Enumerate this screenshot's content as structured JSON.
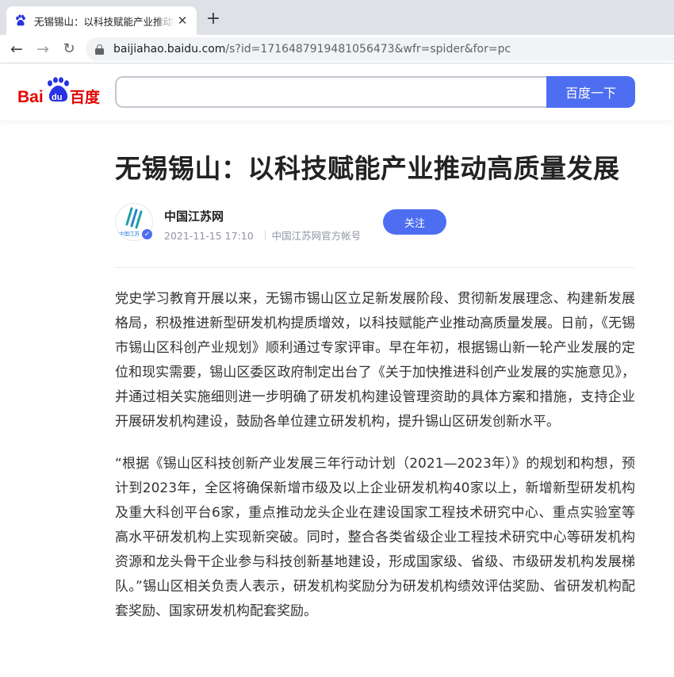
{
  "browser": {
    "tab_title": "无锡锡山：以科技赋能产业推动高质量发展",
    "tab_close": "✕",
    "new_tab": "+",
    "url_host": "baijiahao.baidu.com",
    "url_path": "/s?id=1716487919481056473&wfr=spider&for=pc"
  },
  "header": {
    "logo_text": "Bai du 百度",
    "search_value": "",
    "search_button": "百度一下",
    "brand_blue": "#4e6ef2",
    "brand_red": "#e10602"
  },
  "article": {
    "title": "无锡锡山：以科技赋能产业推动高质量发展",
    "author": {
      "avatar_text": "中国江苏",
      "name": "中国江苏网",
      "date": "2021-11-15 17:10",
      "account": "中国江苏网官方帐号",
      "follow": "关注"
    },
    "paragraphs": [
      "党史学习教育开展以来，无锡市锡山区立足新发展阶段、贯彻新发展理念、构建新发展格局，积极推进新型研发机构提质增效，以科技赋能产业推动高质量发展。日前，《无锡市锡山区科创产业规划》顺利通过专家评审。早在年初，根据锡山新一轮产业发展的定位和现实需要，锡山区委区政府制定出台了《关于加快推进科创产业发展的实施意见》，并通过相关实施细则进一步明确了研发机构建设管理资助的具体方案和措施，支持企业开展研发机构建设，鼓励各单位建立研发机构，提升锡山区研发创新水平。",
      "“根据《锡山区科技创新产业发展三年行动计划（2021—2023年）》的规划和构想，预计到2023年，全区将确保新增市级及以上企业研发机构40家以上，新增新型研发机构及重大科创平台6家，重点推动龙头企业在建设国家工程技术研究中心、重点实验室等高水平研发机构上实现新突破。同时，整合各类省级企业工程技术研究中心等研发机构资源和龙头骨干企业参与科技创新基地建设，形成国家级、省级、市级研发机构发展梯队。”锡山区相关负责人表示，研发机构奖励分为研发机构绩效评估奖励、省研发机构配套奖励、国家研发机构配套奖励。"
    ]
  },
  "icons": {
    "back": "arrow-left-icon",
    "forward": "arrow-right-icon",
    "reload": "reload-icon",
    "lock": "lock-icon",
    "favicon": "baidu-paw-icon",
    "verified": "verified-icon"
  }
}
